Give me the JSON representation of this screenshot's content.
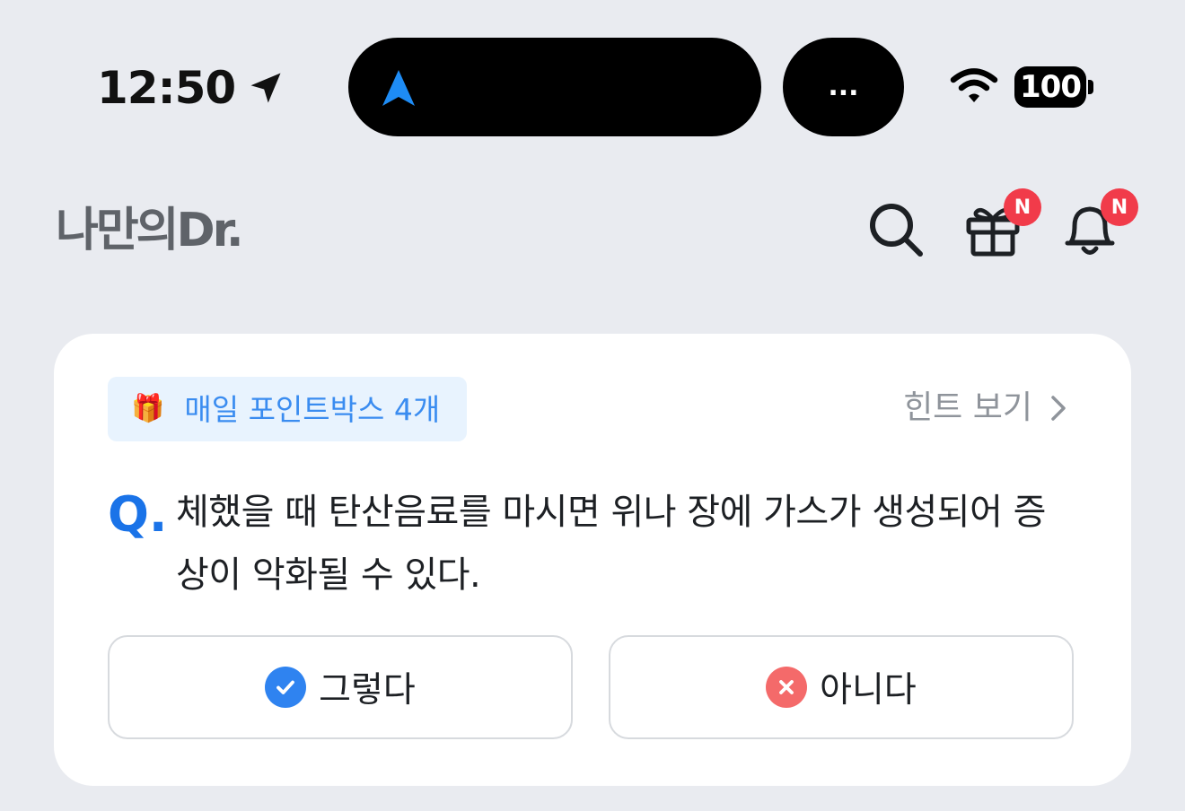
{
  "status_bar": {
    "time": "12:50",
    "more_label": "...",
    "battery_level": "100"
  },
  "header": {
    "logo_text": "나만의Dr.",
    "icons": [
      "search-icon",
      "gift-icon",
      "bell-icon"
    ],
    "gift_badge": "N",
    "bell_badge": "N"
  },
  "quiz": {
    "point_icon": "🎁",
    "point_tag": "매일 포인트박스 4개",
    "hint_label": "힌트 보기",
    "question_marker": "Q.",
    "question": "체했을 때 탄산음료를 마시면 위나 장에 가스가 생성되어 증상이 악화될 수 있다.",
    "answer_yes": "그렇다",
    "answer_no": "아니다"
  },
  "colors": {
    "accent_blue": "#1a73e8",
    "check_blue": "#2f83f0",
    "cross_red": "#f46a6a",
    "badge_red": "#f13b4a",
    "tag_bg": "#e8f3fe",
    "tag_text": "#3a8cf0",
    "page_bg": "#e9ebf0"
  }
}
